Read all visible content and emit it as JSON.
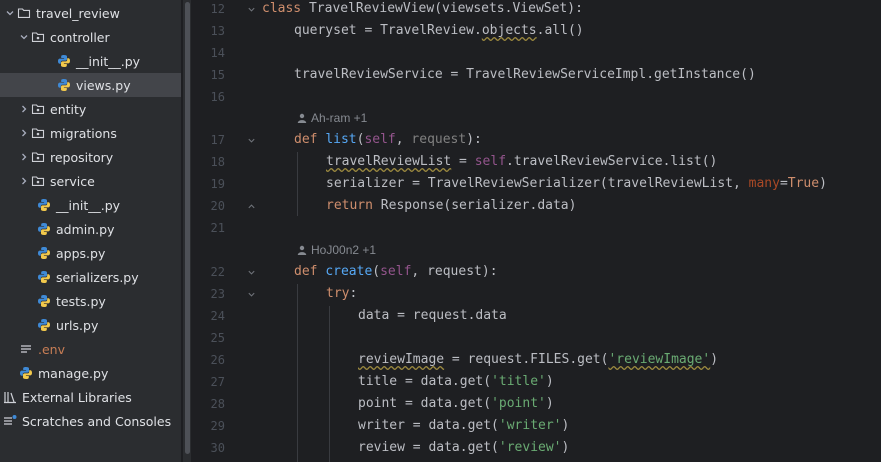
{
  "project_tree": {
    "items": [
      {
        "label": "travel_review",
        "icon": "folder-icon"
      },
      {
        "label": "controller",
        "icon": "folder-icon"
      },
      {
        "label": "__init__.py",
        "icon": "python-file-icon"
      },
      {
        "label": "views.py",
        "icon": "python-file-icon",
        "selected": true
      },
      {
        "label": "entity",
        "icon": "folder-icon"
      },
      {
        "label": "migrations",
        "icon": "folder-icon"
      },
      {
        "label": "repository",
        "icon": "folder-icon"
      },
      {
        "label": "service",
        "icon": "folder-icon"
      },
      {
        "label": "__init__.py",
        "icon": "python-file-icon"
      },
      {
        "label": "admin.py",
        "icon": "python-file-icon"
      },
      {
        "label": "apps.py",
        "icon": "python-file-icon"
      },
      {
        "label": "serializers.py",
        "icon": "python-file-icon"
      },
      {
        "label": "tests.py",
        "icon": "python-file-icon"
      },
      {
        "label": "urls.py",
        "icon": "python-file-icon"
      },
      {
        "label": ".env",
        "icon": "text-file-icon"
      },
      {
        "label": "manage.py",
        "icon": "python-file-icon"
      },
      {
        "label": "External Libraries",
        "icon": "library-icon"
      },
      {
        "label": "Scratches and Consoles",
        "icon": "scratches-icon"
      }
    ]
  },
  "editor": {
    "line_numbers": [
      "12",
      "13",
      "14",
      "15",
      "16",
      "17",
      "18",
      "19",
      "20",
      "21",
      "22",
      "23",
      "24",
      "25",
      "26",
      "27",
      "28",
      "29",
      "30"
    ],
    "author_hints": [
      "Ah-ram +1",
      "HoJ00n2 +1"
    ],
    "code": {
      "l12": {
        "kw": "class",
        "rest": " TravelReviewView(viewsets.ViewSet):"
      },
      "l13": {
        "a": "queryset = TravelReview.",
        "b": "objects",
        "c": ".all()"
      },
      "l15": {
        "text": "travelReviewService = TravelReviewServiceImpl.getInstance()"
      },
      "l17": {
        "kw": "def",
        "fn": "list",
        "p1": "(",
        "self": "self",
        "p2": ", ",
        "req": "request",
        "p3": "):"
      },
      "l18": {
        "a": "travelReviewList",
        "b": " = ",
        "self": "self",
        "c": ".travelReviewService.list()"
      },
      "l19": {
        "a": "serializer = TravelReviewSerializer(travelReviewList, ",
        "kwa": "many",
        "b": "=",
        "kw": "True",
        "c": ")"
      },
      "l20": {
        "kw": "return",
        "rest": " Response(serializer.data)"
      },
      "l22": {
        "kw": "def",
        "fn": "create",
        "p1": "(",
        "self": "self",
        "rest": ", request):"
      },
      "l23": {
        "kw": "try",
        "rest": ":"
      },
      "l24": {
        "text": "data = request.data"
      },
      "l26": {
        "a": "reviewImage",
        "b": " = request.FILES.get(",
        "str": "'reviewImage'",
        "c": ")"
      },
      "l27": {
        "a": "title = data.get(",
        "str": "'title'",
        "c": ")"
      },
      "l28": {
        "a": "point = data.get(",
        "str": "'point'",
        "c": ")"
      },
      "l29": {
        "a": "writer = data.get(",
        "str": "'writer'",
        "c": ")"
      },
      "l30": {
        "a": "review = data.get(",
        "str": "'review'",
        "c": ")"
      }
    }
  }
}
